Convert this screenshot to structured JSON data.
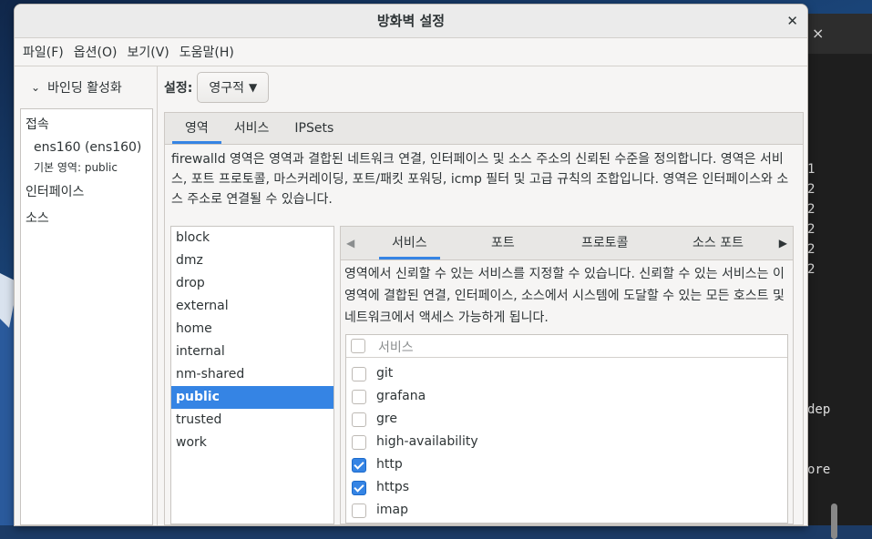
{
  "window": {
    "title": "방화벽 설정"
  },
  "menu": [
    "파일(F)",
    "옵션(O)",
    "보기(V)",
    "도움말(H)"
  ],
  "binding": {
    "toggle_label": "바인딩 활성화"
  },
  "connections": {
    "section_connections": "접속",
    "connection_name": "ens160 (ens160)",
    "connection_zone": "기본 영역: public",
    "section_interfaces": "인터페이스",
    "section_sources": "소스"
  },
  "settings": {
    "label": "설정:",
    "mode": "영구적"
  },
  "main_tabs": [
    "영역",
    "서비스",
    "IPSets"
  ],
  "zone_description": "firewalld 영역은 영역과 결합된 네트워크 연결, 인터페이스 및 소스 주소의 신뢰된 수준을 정의합니다. 영역은 서비스, 포트 프로토콜, 마스커레이딩, 포트/패킷 포워딩, icmp 필터 및 고급 규칙의 조합입니다. 영역은 인터페이스와 소스 주소로 연결될 수 있습니다.",
  "zones": [
    "block",
    "dmz",
    "drop",
    "external",
    "home",
    "internal",
    "nm-shared",
    "public",
    "trusted",
    "work"
  ],
  "selected_zone": "public",
  "sub_tabs": [
    "서비스",
    "포트",
    "프로토콜",
    "소스 포트"
  ],
  "service_description": "영역에서 신뢰할 수 있는 서비스를 지정할 수 있습니다. 신뢰할 수 있는 서비스는 이 영역에 결합된 연결, 인터페이스, 소스에서 시스템에 도달할 수 있는 모든 호스트 및 네트워크에서 액세스 가능하게 됩니다.",
  "services_header": "서비스",
  "services": [
    {
      "name": "git",
      "checked": false
    },
    {
      "name": "grafana",
      "checked": false
    },
    {
      "name": "gre",
      "checked": false
    },
    {
      "name": "high-availability",
      "checked": false
    },
    {
      "name": "http",
      "checked": true
    },
    {
      "name": "https",
      "checked": true
    },
    {
      "name": "imap",
      "checked": false
    }
  ],
  "terminal": {
    "close": "×",
    "lines": [
      "1",
      "2",
      "2",
      "2",
      "2",
      "2",
      "dep",
      "ore"
    ]
  },
  "colors": {
    "accent": "#3584e4"
  }
}
